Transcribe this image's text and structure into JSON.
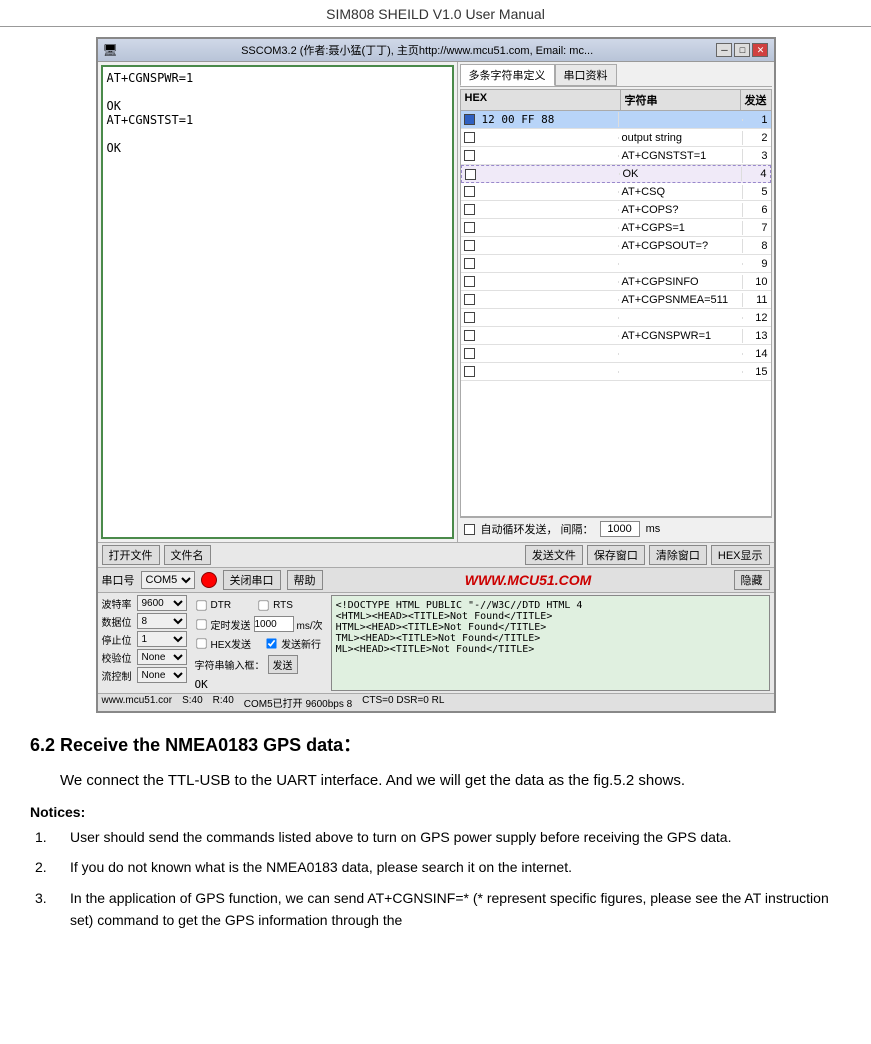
{
  "header": {
    "title": "SIM808 SHEILD V1.0 User Manual"
  },
  "window": {
    "title": "SSCOM3.2 (作者:聂小猛(丁丁), 主页http://www.mcu51.com,  Email: mc...",
    "btn_min": "─",
    "btn_max": "□",
    "btn_close": "✕"
  },
  "serial_output": {
    "lines": [
      "AT+CGNSPWR=1",
      "",
      "OK",
      "AT+CGNSTST=1",
      "",
      "OK"
    ]
  },
  "tabs": {
    "tab1": "多条字符串定义",
    "tab2": "串口资料"
  },
  "hex_table": {
    "header_hex": "HEX",
    "header_str": "字符串",
    "header_send": "发送",
    "rows": [
      {
        "checked": true,
        "hex": "12 00 FF 88",
        "str": "",
        "num": "1"
      },
      {
        "checked": false,
        "hex": "",
        "str": "output string",
        "num": "2"
      },
      {
        "checked": false,
        "hex": "",
        "str": "AT+CGNSTST=1",
        "num": "3"
      },
      {
        "checked": false,
        "hex": "",
        "str": "OK",
        "num": "4",
        "dotted": true
      },
      {
        "checked": false,
        "hex": "",
        "str": "AT+CSQ",
        "num": "5"
      },
      {
        "checked": false,
        "hex": "",
        "str": "AT+COPS?",
        "num": "6"
      },
      {
        "checked": false,
        "hex": "",
        "str": "AT+CGPS=1",
        "num": "7"
      },
      {
        "checked": false,
        "hex": "",
        "str": "AT+CGPSOUT=?",
        "num": "8"
      },
      {
        "checked": false,
        "hex": "",
        "str": "",
        "num": "9"
      },
      {
        "checked": false,
        "hex": "",
        "str": "AT+CGPSINFO",
        "num": "10"
      },
      {
        "checked": false,
        "hex": "",
        "str": "AT+CGPSNMEA=511",
        "num": "11"
      },
      {
        "checked": false,
        "hex": "",
        "str": "",
        "num": "12"
      },
      {
        "checked": false,
        "hex": "",
        "str": "AT+CGNSPWR=1",
        "num": "13"
      },
      {
        "checked": false,
        "hex": "",
        "str": "",
        "num": "14"
      },
      {
        "checked": false,
        "hex": "",
        "str": "",
        "num": "15"
      }
    ]
  },
  "auto_loop": {
    "label": "自动循环发送，  间隔：",
    "value": "1000",
    "unit": "ms"
  },
  "bottom_toolbar": {
    "btn1": "打开文件",
    "btn2": "文件名",
    "btn3": "发送文件",
    "btn4": "保存窗口",
    "btn5": "清除窗口",
    "btn6": "HEX显示"
  },
  "serial_ctrl": {
    "port_label": "串口号",
    "port_value": "COM5",
    "close_btn": "关闭串口",
    "help_btn": "帮助",
    "website": "WWW.MCU51.COM",
    "hide_btn": "隐藏"
  },
  "settings": {
    "baud_label": "波特率",
    "baud_value": "9600",
    "data_label": "数据位",
    "data_value": "8",
    "stop_label": "停止位",
    "stop_value": "1",
    "check_label": "校验位",
    "check_value": "None",
    "flow_label": "流控制",
    "flow_value": "None",
    "dtr_label": "DTR",
    "rts_label": "RTS",
    "timer_label": "定时发送",
    "timer_value": "1000",
    "timer_unit": "ms/次",
    "hex_send": "HEX发送",
    "resend_label": "发送新行",
    "str_input_label": "字符串输入框：",
    "str_send_btn": "发送",
    "ok_display": "OK"
  },
  "right_output": {
    "lines": [
      "<!DOCTYPE HTML PUBLIC \"-//W3C//DTD HTML 4",
      "<HTML><HEAD><TITLE>Not Found</TITLE>",
      "HTML><HEAD><TITLE>Not Found</TITLE>",
      "TML><HEAD><TITLE>Not Found</TITLE>",
      "ML><HEAD><TITLE>Not Found</TITLE>"
    ]
  },
  "status_bar": {
    "website": "www.mcu51.cor",
    "s_value": "S:40",
    "r_value": "R:40",
    "port_status": "COM5已打开  9600bps  8",
    "cts": "CTS=0 DSR=0 RL"
  },
  "section": {
    "heading": "6.2 Receive the NMEA0183 GPS data：",
    "body": "We connect the TTL-USB to the UART interface. And we will get the data as the fig.5.2 shows.",
    "notices_heading": "Notices:",
    "notices": [
      {
        "num": "1.",
        "text": "User should send the commands listed above to turn on GPS power supply before receiving the GPS data."
      },
      {
        "num": "2.",
        "text": "If you do not known what is the NMEA0183 data, please search it on the internet."
      },
      {
        "num": "3.",
        "text": "In the application of GPS function, we can send AT+CGNSINF=* (* represent specific figures, please see the AT instruction set) command to get the GPS information through the"
      }
    ]
  }
}
